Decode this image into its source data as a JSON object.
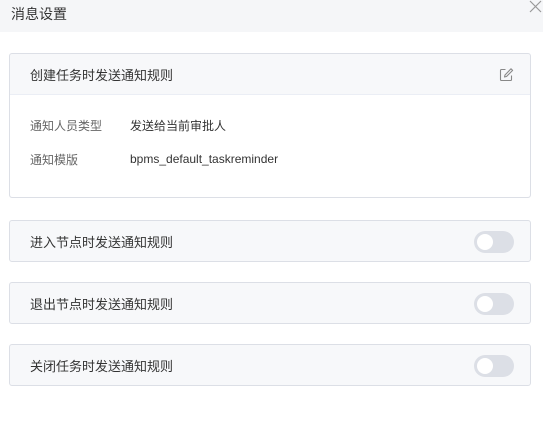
{
  "dialog": {
    "title": "消息设置"
  },
  "panels": [
    {
      "title": "创建任务时发送通知规则",
      "expanded": true,
      "fields": [
        {
          "label": "通知人员类型",
          "value": "发送给当前审批人"
        },
        {
          "label": "通知模版",
          "value": "bpms_default_taskreminder"
        }
      ]
    },
    {
      "title": "进入节点时发送通知规则",
      "enabled": false
    },
    {
      "title": "退出节点时发送通知规则",
      "enabled": false
    },
    {
      "title": "关闭任务时发送通知规则",
      "enabled": false
    }
  ],
  "colors": {
    "header_bg": "#f5f6f8",
    "panel_bg": "#f7f8fa",
    "border": "#dcdfe6",
    "toggle_off": "#dcdfe6"
  },
  "icons": {
    "close": "close-icon",
    "edit": "edit-icon"
  }
}
